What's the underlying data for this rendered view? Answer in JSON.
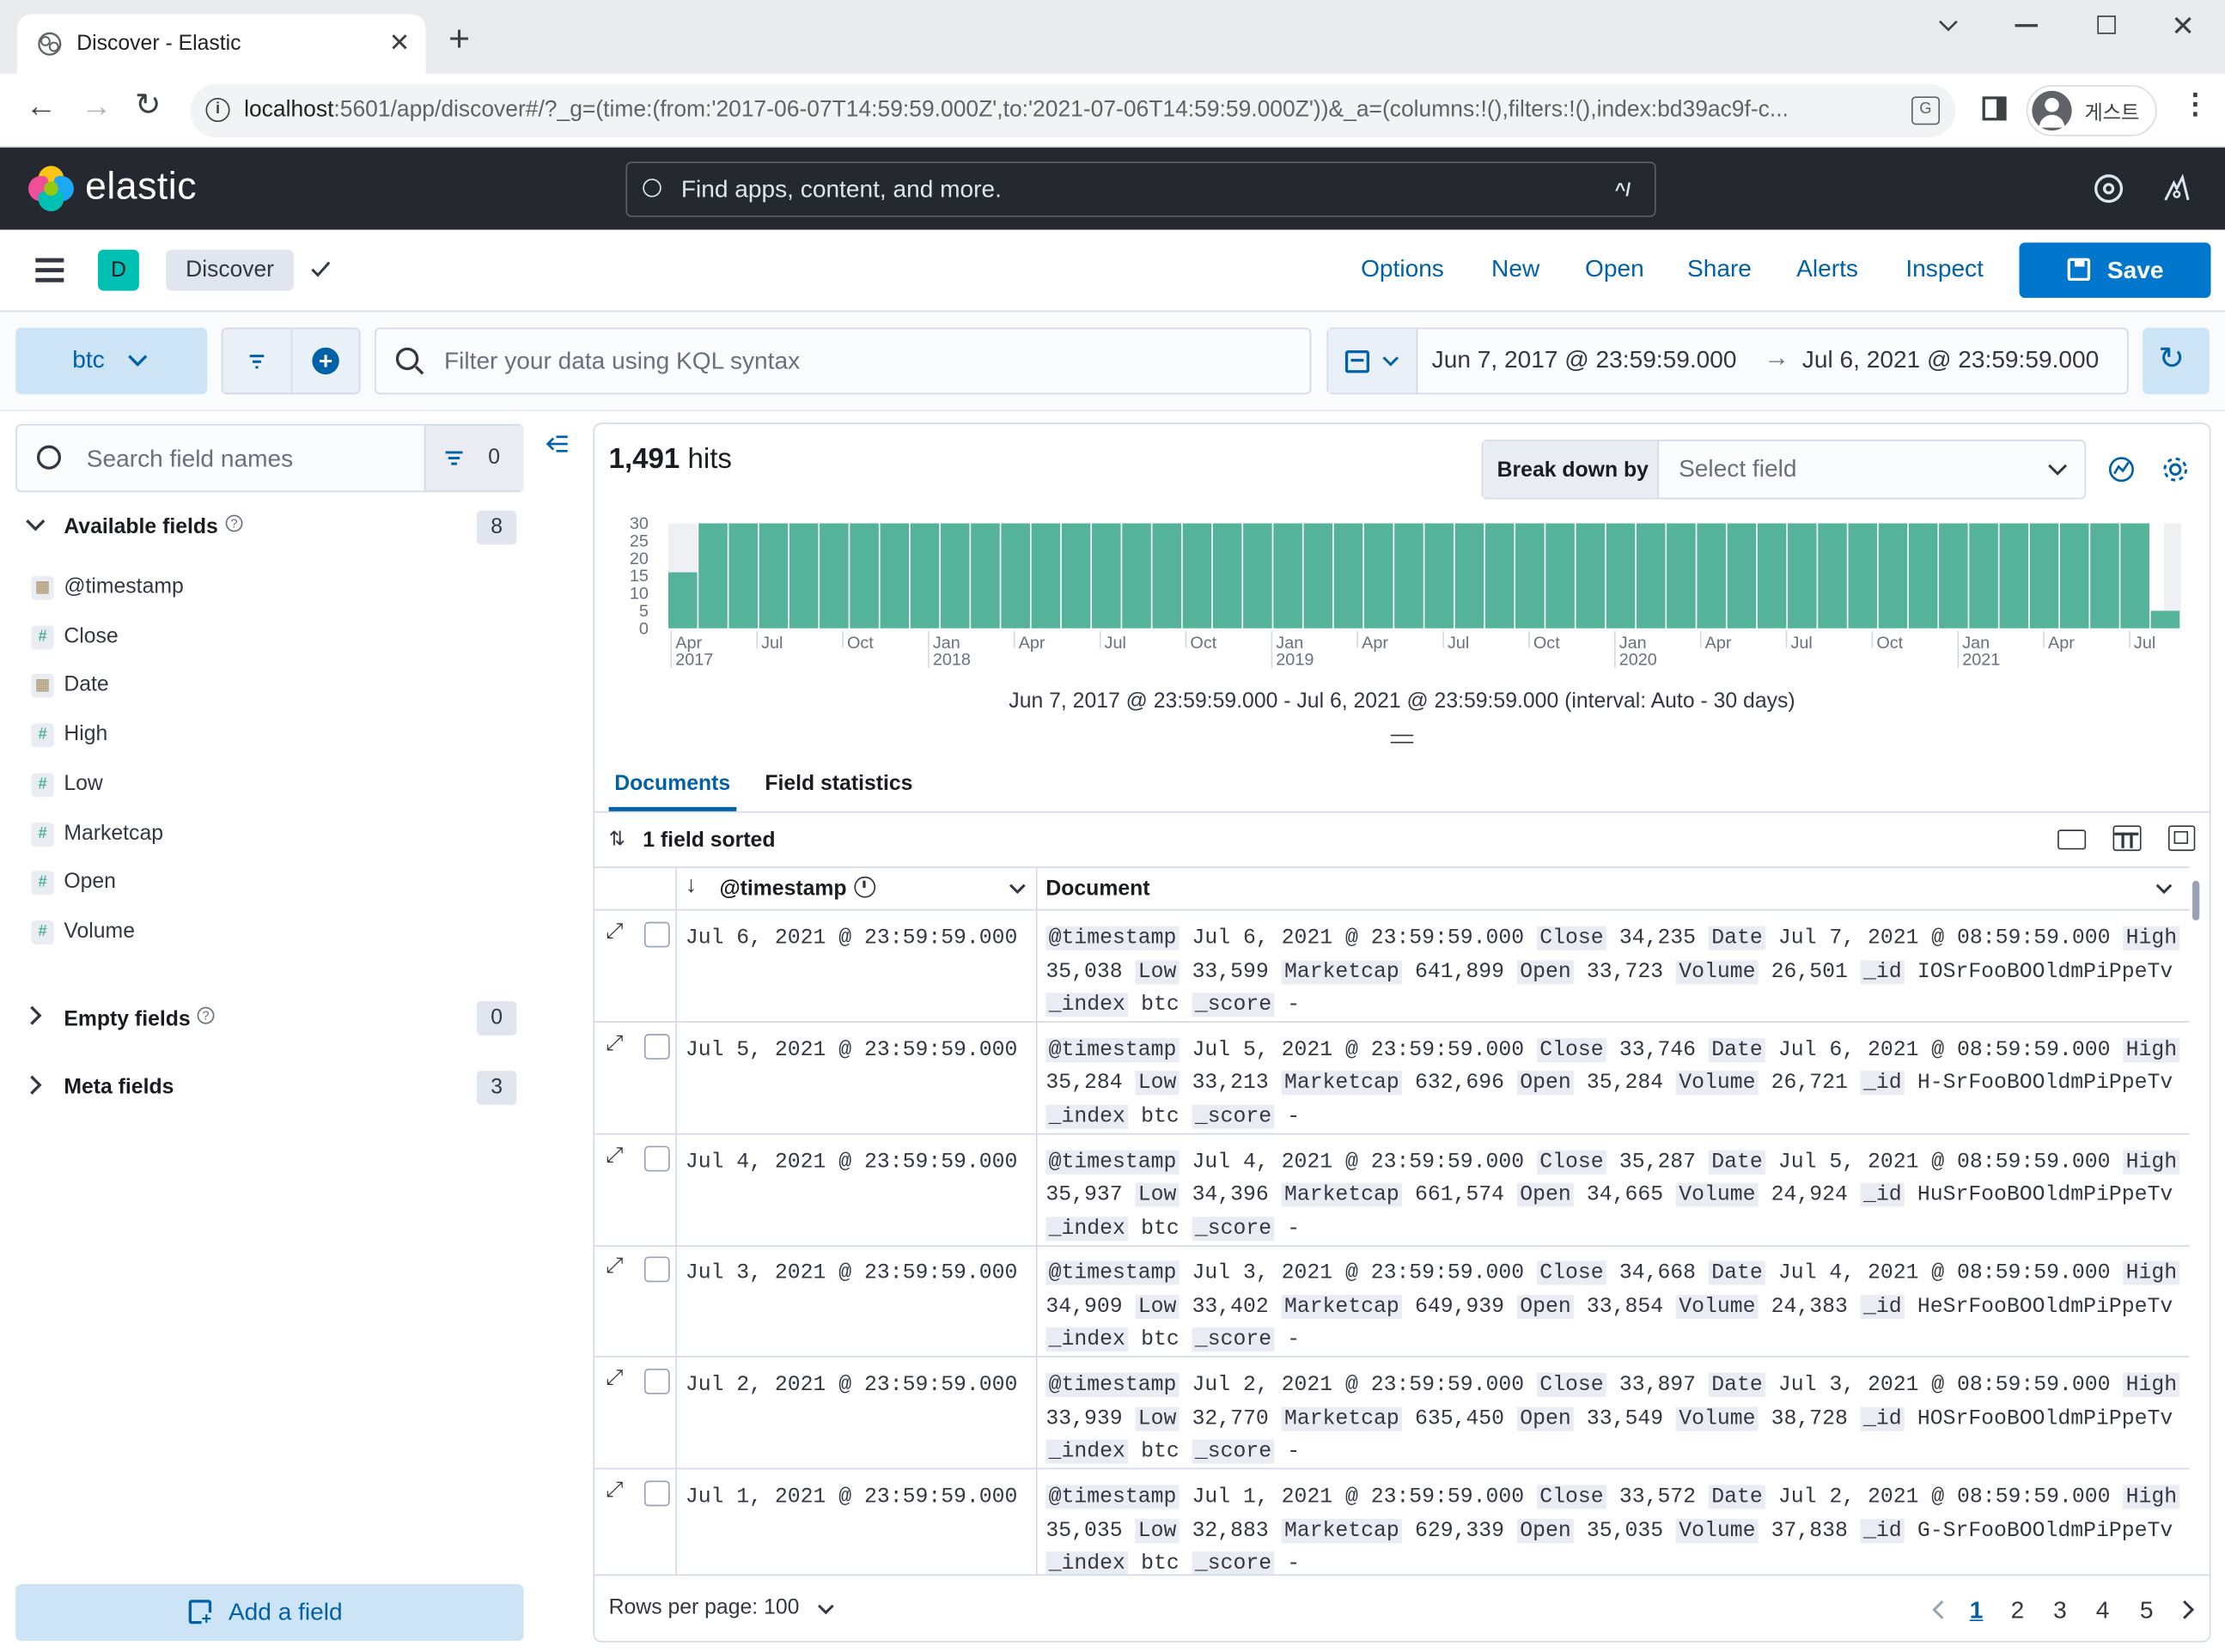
{
  "browser": {
    "tab_title": "Discover - Elastic",
    "url_host": "localhost",
    "url_rest": ":5601/app/discover#/?_g=(time:(from:'2017-06-07T14:59:59.000Z',to:'2021-07-06T14:59:59.000Z'))&_a=(columns:!(),filters:!(),index:bd39ac9f-c...",
    "profile_label": "게스트"
  },
  "header": {
    "logo_text": "elastic",
    "search_placeholder": "Find apps, content, and more.",
    "search_shortcut": "^/"
  },
  "appbar": {
    "space_letter": "D",
    "breadcrumb": "Discover",
    "links": [
      "Options",
      "New",
      "Open",
      "Share",
      "Alerts",
      "Inspect"
    ],
    "save_label": "Save"
  },
  "query": {
    "data_view": "btc",
    "kql_placeholder": "Filter your data using KQL syntax",
    "time_from": "Jun 7, 2017 @ 23:59:59.000",
    "time_to": "Jul 6, 2021 @ 23:59:59.000"
  },
  "sidebar": {
    "search_placeholder": "Search field names",
    "filter_count": "0",
    "available_label": "Available fields",
    "available_count": "8",
    "fields": [
      {
        "type": "date",
        "name": "@timestamp"
      },
      {
        "type": "number",
        "name": "Close"
      },
      {
        "type": "date",
        "name": "Date"
      },
      {
        "type": "number",
        "name": "High"
      },
      {
        "type": "number",
        "name": "Low"
      },
      {
        "type": "number",
        "name": "Marketcap"
      },
      {
        "type": "number",
        "name": "Open"
      },
      {
        "type": "number",
        "name": "Volume"
      }
    ],
    "empty_label": "Empty fields",
    "empty_count": "0",
    "meta_label": "Meta fields",
    "meta_count": "3",
    "add_field_label": "Add a field"
  },
  "histogram": {
    "hits_count": "1,491",
    "hits_label": "hits",
    "breakdown_label": "Break down by",
    "breakdown_placeholder": "Select field",
    "interval_caption": "Jun 7, 2017 @ 23:59:59.000 - Jul 6, 2021 @ 23:59:59.000 (interval: Auto - 30 days)"
  },
  "chart_data": {
    "type": "bar",
    "ylim": [
      0,
      30
    ],
    "y_ticks": [
      "0",
      "5",
      "10",
      "15",
      "20",
      "25",
      "30"
    ],
    "x_ticks": [
      {
        "label": "Apr",
        "sub": "2017"
      },
      {
        "label": "Jul",
        "sub": ""
      },
      {
        "label": "Oct",
        "sub": ""
      },
      {
        "label": "Jan",
        "sub": "2018"
      },
      {
        "label": "Apr",
        "sub": ""
      },
      {
        "label": "Jul",
        "sub": ""
      },
      {
        "label": "Oct",
        "sub": ""
      },
      {
        "label": "Jan",
        "sub": "2019"
      },
      {
        "label": "Apr",
        "sub": ""
      },
      {
        "label": "Jul",
        "sub": ""
      },
      {
        "label": "Oct",
        "sub": ""
      },
      {
        "label": "Jan",
        "sub": "2020"
      },
      {
        "label": "Apr",
        "sub": ""
      },
      {
        "label": "Jul",
        "sub": ""
      },
      {
        "label": "Oct",
        "sub": ""
      },
      {
        "label": "Jan",
        "sub": "2021"
      },
      {
        "label": "Apr",
        "sub": ""
      },
      {
        "label": "Jul",
        "sub": ""
      }
    ],
    "values": [
      16,
      30,
      30,
      30,
      30,
      30,
      30,
      30,
      30,
      30,
      30,
      30,
      30,
      30,
      30,
      30,
      30,
      30,
      30,
      30,
      30,
      30,
      30,
      30,
      30,
      30,
      30,
      30,
      30,
      30,
      30,
      30,
      30,
      30,
      30,
      30,
      30,
      30,
      30,
      30,
      30,
      30,
      30,
      30,
      30,
      30,
      30,
      30,
      30,
      5
    ]
  },
  "documents": {
    "tab_documents": "Documents",
    "tab_stats": "Field statistics",
    "sorted_label": "1 field sorted",
    "col_timestamp": "@timestamp",
    "col_document": "Document",
    "rows": [
      {
        "ts": "Jul 6, 2021 @ 23:59:59.000",
        "fields": [
          [
            "@timestamp",
            "Jul 6, 2021 @ 23:59:59.000"
          ],
          [
            "Close",
            "34,235"
          ],
          [
            "Date",
            "Jul 7, 2021 @ 08:59:59.000"
          ],
          [
            "High",
            "35,038"
          ],
          [
            "Low",
            "33,599"
          ],
          [
            "Marketcap",
            "641,899"
          ],
          [
            "Open",
            "33,723"
          ],
          [
            "Volume",
            "26,501"
          ],
          [
            "_id",
            "IOSrFooBOOldmPiPpeTv"
          ],
          [
            "_index",
            "btc"
          ],
          [
            "_score",
            "-"
          ]
        ]
      },
      {
        "ts": "Jul 5, 2021 @ 23:59:59.000",
        "fields": [
          [
            "@timestamp",
            "Jul 5, 2021 @ 23:59:59.000"
          ],
          [
            "Close",
            "33,746"
          ],
          [
            "Date",
            "Jul 6, 2021 @ 08:59:59.000"
          ],
          [
            "High",
            "35,284"
          ],
          [
            "Low",
            "33,213"
          ],
          [
            "Marketcap",
            "632,696"
          ],
          [
            "Open",
            "35,284"
          ],
          [
            "Volume",
            "26,721"
          ],
          [
            "_id",
            "H-SrFooBOOldmPiPpeTv"
          ],
          [
            "_index",
            "btc"
          ],
          [
            "_score",
            "-"
          ]
        ]
      },
      {
        "ts": "Jul 4, 2021 @ 23:59:59.000",
        "fields": [
          [
            "@timestamp",
            "Jul 4, 2021 @ 23:59:59.000"
          ],
          [
            "Close",
            "35,287"
          ],
          [
            "Date",
            "Jul 5, 2021 @ 08:59:59.000"
          ],
          [
            "High",
            "35,937"
          ],
          [
            "Low",
            "34,396"
          ],
          [
            "Marketcap",
            "661,574"
          ],
          [
            "Open",
            "34,665"
          ],
          [
            "Volume",
            "24,924"
          ],
          [
            "_id",
            "HuSrFooBOOldmPiPpeTv"
          ],
          [
            "_index",
            "btc"
          ],
          [
            "_score",
            "-"
          ]
        ]
      },
      {
        "ts": "Jul 3, 2021 @ 23:59:59.000",
        "fields": [
          [
            "@timestamp",
            "Jul 3, 2021 @ 23:59:59.000"
          ],
          [
            "Close",
            "34,668"
          ],
          [
            "Date",
            "Jul 4, 2021 @ 08:59:59.000"
          ],
          [
            "High",
            "34,909"
          ],
          [
            "Low",
            "33,402"
          ],
          [
            "Marketcap",
            "649,939"
          ],
          [
            "Open",
            "33,854"
          ],
          [
            "Volume",
            "24,383"
          ],
          [
            "_id",
            "HeSrFooBOOldmPiPpeTv"
          ],
          [
            "_index",
            "btc"
          ],
          [
            "_score",
            "-"
          ]
        ]
      },
      {
        "ts": "Jul 2, 2021 @ 23:59:59.000",
        "fields": [
          [
            "@timestamp",
            "Jul 2, 2021 @ 23:59:59.000"
          ],
          [
            "Close",
            "33,897"
          ],
          [
            "Date",
            "Jul 3, 2021 @ 08:59:59.000"
          ],
          [
            "High",
            "33,939"
          ],
          [
            "Low",
            "32,770"
          ],
          [
            "Marketcap",
            "635,450"
          ],
          [
            "Open",
            "33,549"
          ],
          [
            "Volume",
            "38,728"
          ],
          [
            "_id",
            "HOSrFooBOOldmPiPpeTv"
          ],
          [
            "_index",
            "btc"
          ],
          [
            "_score",
            "-"
          ]
        ]
      },
      {
        "ts": "Jul 1, 2021 @ 23:59:59.000",
        "fields": [
          [
            "@timestamp",
            "Jul 1, 2021 @ 23:59:59.000"
          ],
          [
            "Close",
            "33,572"
          ],
          [
            "Date",
            "Jul 2, 2021 @ 08:59:59.000"
          ],
          [
            "High",
            "35,035"
          ],
          [
            "Low",
            "32,883"
          ],
          [
            "Marketcap",
            "629,339"
          ],
          [
            "Open",
            "35,035"
          ],
          [
            "Volume",
            "37,838"
          ],
          [
            "_id",
            "G-SrFooBOOldmPiPpeTv"
          ],
          [
            "_index",
            "btc"
          ],
          [
            "_score",
            "-"
          ]
        ]
      }
    ],
    "rows_per_page": "Rows per page: 100",
    "pages": [
      "1",
      "2",
      "3",
      "4",
      "5"
    ]
  }
}
